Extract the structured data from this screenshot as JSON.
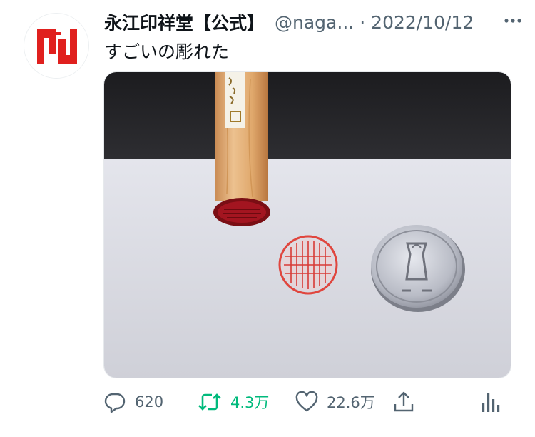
{
  "tweet": {
    "author": {
      "display_name": "永江印祥堂【公式】",
      "handle": "@naga...",
      "separator": "·",
      "avatar_icon": "naganoe-logo-icon",
      "brand_color": "#e0201e"
    },
    "date": "2022/10/12",
    "text": "すごいの彫れた",
    "media": {
      "type": "photo",
      "icon": "hanko-photo"
    },
    "actions": {
      "reply": {
        "icon": "reply-icon",
        "count": "620"
      },
      "retweet": {
        "icon": "retweet-icon",
        "count": "4.3万",
        "color": "#00ba7c"
      },
      "like": {
        "icon": "heart-icon",
        "count": "22.6万"
      },
      "share": {
        "icon": "share-icon"
      },
      "analytics": {
        "icon": "analytics-icon"
      }
    },
    "more_icon": "more-icon"
  }
}
